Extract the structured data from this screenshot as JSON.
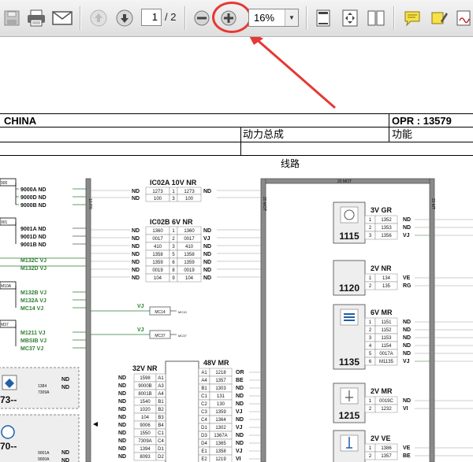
{
  "toolbar": {
    "page_current": "1",
    "page_total": "/ 2",
    "zoom": "16%"
  },
  "header": {
    "country": "CHINA",
    "opr": "OPR : 13579",
    "powertrain": "动力总成",
    "function": "功能",
    "circuit": "线路"
  },
  "left_column": {
    "connectors": [
      "900",
      "901",
      "M10A",
      "M37"
    ],
    "labels_9000": [
      "9000A ND",
      "9000D ND",
      "9000B ND"
    ],
    "labels_9001": [
      "9001A ND",
      "9001D ND",
      "9001B ND"
    ],
    "labels_m132": [
      "M132C VJ",
      "M132D VJ"
    ],
    "labels_m10a": [
      "M132B VJ",
      "M132A VJ",
      "MC14 VJ"
    ],
    "labels_m37": [
      "M1211 VJ",
      "MBSIB VJ",
      "MC37 VJ"
    ],
    "box1_lines": [
      "1384",
      "7309A"
    ],
    "box1_nd": [
      "ND",
      "ND"
    ],
    "box1_code": "73--",
    "box2_lines": [
      "9001A",
      "9000A"
    ],
    "box2_nd": [
      "ND",
      "ND"
    ],
    "box2_code": "70--"
  },
  "ic02a": {
    "title": "IC02A  10V NR",
    "rows": [
      [
        "ND",
        "1273",
        "1",
        "1273",
        "ND"
      ],
      [
        "ND",
        "100",
        "3",
        "100",
        ""
      ]
    ]
  },
  "ic02b": {
    "title": "IC02B  6V NR",
    "rows": [
      [
        "ND",
        "1360",
        "1",
        "1360",
        "ND"
      ],
      [
        "ND",
        "0017",
        "2",
        "0017",
        "VJ"
      ],
      [
        "ND",
        "410",
        "3",
        "410",
        "ND"
      ],
      [
        "ND",
        "1358",
        "5",
        "1358",
        "ND"
      ],
      [
        "ND",
        "1359",
        "6",
        "1359",
        "ND"
      ],
      [
        "ND",
        "0019",
        "8",
        "0019",
        "ND"
      ],
      [
        "ND",
        "104",
        "9",
        "104",
        "ND"
      ]
    ]
  },
  "mc_refs": [
    {
      "label": "VJ",
      "box": "MC14",
      "tag": "MC10"
    },
    {
      "label": "VJ",
      "box": "MC37",
      "tag": "MC37"
    }
  ],
  "conn32": {
    "title": "32V NR",
    "rows": [
      [
        "ND",
        "1598",
        "A1"
      ],
      [
        "ND",
        "9000B",
        "A3"
      ],
      [
        "ND",
        "8001B",
        "A4"
      ],
      [
        "ND",
        "1540",
        "B1"
      ],
      [
        "ND",
        "1020",
        "B2"
      ],
      [
        "ND",
        "104",
        "B3"
      ],
      [
        "ND",
        "9006",
        "B4"
      ],
      [
        "ND",
        "1550",
        "C1"
      ],
      [
        "ND",
        "7309A",
        "C4"
      ],
      [
        "ND",
        "1394",
        "D1"
      ],
      [
        "ND",
        "8093",
        "D2"
      ]
    ]
  },
  "conn48": {
    "title": "48V MR",
    "rows": [
      [
        "A1",
        "1218",
        "OR"
      ],
      [
        "A4",
        "1357",
        "BE"
      ],
      [
        "B1",
        "1303",
        "ND"
      ],
      [
        "C1",
        "131",
        "ND"
      ],
      [
        "C2",
        "130",
        "ND"
      ],
      [
        "C3",
        "1359",
        "VJ"
      ],
      [
        "C4",
        "1364",
        "ND"
      ],
      [
        "D1",
        "1302",
        "VJ"
      ],
      [
        "D3",
        "1367A",
        "ND"
      ],
      [
        "D4",
        "1365",
        "ND"
      ],
      [
        "E1",
        "1358",
        "VJ"
      ],
      [
        "E2",
        "1219",
        "VI"
      ]
    ]
  },
  "frame_tags": [
    "20 MOT",
    "10 PR",
    "20 MOT",
    "20 MT"
  ],
  "components": [
    {
      "id": "1115",
      "conn": "3V GR",
      "icon": "gauge-icon",
      "rows": [
        [
          "1",
          "1352",
          "ND"
        ],
        [
          "2",
          "1353",
          "ND"
        ],
        [
          "3",
          "1356",
          "VJ"
        ]
      ]
    },
    {
      "id": "1120",
      "conn": "2V NR",
      "icon": "none",
      "rows": [
        [
          "1",
          "134",
          "VE"
        ],
        [
          "2",
          "135",
          "RG"
        ]
      ]
    },
    {
      "id": "1135",
      "conn": "6V MR",
      "icon": "fan-icon",
      "rows": [
        [
          "1",
          "1151",
          "ND"
        ],
        [
          "2",
          "1152",
          "ND"
        ],
        [
          "3",
          "1153",
          "ND"
        ],
        [
          "4",
          "1154",
          "ND"
        ],
        [
          "5",
          "0017A",
          "ND"
        ],
        [
          "6",
          "M1135",
          "VJ"
        ]
      ]
    },
    {
      "id": "1215",
      "conn": "2V MR",
      "icon": "valve-icon",
      "rows": [
        [
          "1",
          "0019C",
          "ND"
        ],
        [
          "2",
          "1232",
          "VI"
        ]
      ]
    },
    {
      "id": "",
      "conn": "2V VE",
      "icon": "temp-icon",
      "rows": [
        [
          "1",
          "1386",
          "VE"
        ],
        [
          "2",
          "1357",
          "BE"
        ]
      ]
    }
  ]
}
